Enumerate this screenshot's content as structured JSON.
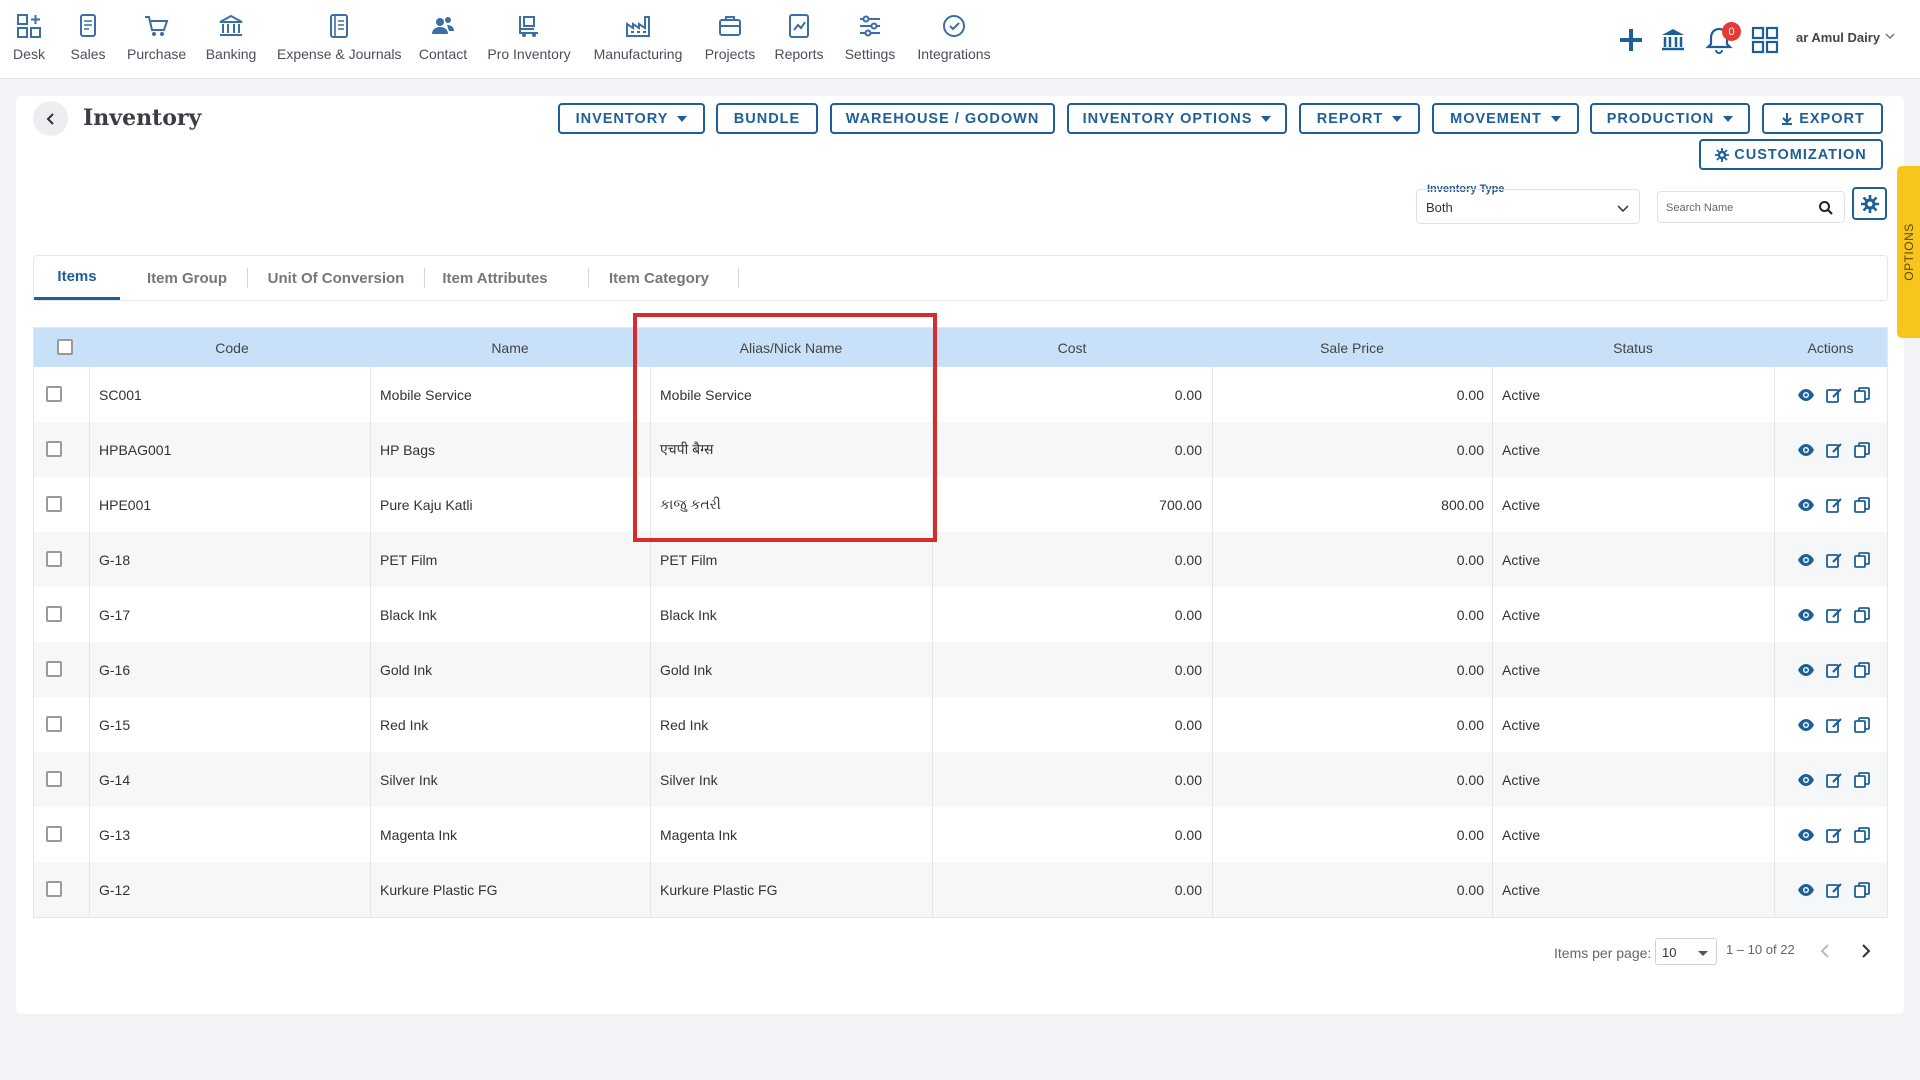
{
  "nav": {
    "items": [
      {
        "label": "Desk",
        "icon": "desk-icon"
      },
      {
        "label": "Sales",
        "icon": "sales-icon"
      },
      {
        "label": "Purchase",
        "icon": "cart-icon"
      },
      {
        "label": "Banking",
        "icon": "bank-icon"
      },
      {
        "label": "Expense & Journals",
        "icon": "journal-icon"
      },
      {
        "label": "Contact",
        "icon": "contacts-icon"
      },
      {
        "label": "Pro Inventory",
        "icon": "inventory-icon"
      },
      {
        "label": "Manufacturing",
        "icon": "factory-icon"
      },
      {
        "label": "Projects",
        "icon": "projects-icon"
      },
      {
        "label": "Reports",
        "icon": "reports-icon"
      },
      {
        "label": "Settings",
        "icon": "settings-sliders-icon"
      },
      {
        "label": "Integrations",
        "icon": "integrations-icon"
      }
    ],
    "notification_count": "0",
    "company": "ar Amul Dairy"
  },
  "page": {
    "title": "Inventory",
    "buttons": {
      "inventory": "INVENTORY",
      "bundle": "BUNDLE",
      "warehouse": "WAREHOUSE / GODOWN",
      "inventory_options": "INVENTORY OPTIONS",
      "report": "REPORT",
      "movement": "MOVEMENT",
      "production": "PRODUCTION",
      "export": "EXPORT",
      "customization": "CUSTOMIZATION"
    },
    "filter": {
      "inventory_type_label": "Inventory Type",
      "inventory_type_value": "Both",
      "search_placeholder": "Search Name"
    },
    "options_tab": "OPTIONS"
  },
  "tabs": [
    "Items",
    "Item Group",
    "Unit Of Conversion",
    "Item Attributes",
    "Item Category"
  ],
  "table": {
    "columns": [
      "Code",
      "Name",
      "Alias/Nick Name",
      "Cost",
      "Sale Price",
      "Status",
      "Actions"
    ],
    "rows": [
      {
        "code": "SC001",
        "name": "Mobile Service",
        "alias": "Mobile Service",
        "cost": "0.00",
        "sale": "0.00",
        "status": "Active"
      },
      {
        "code": "HPBAG001",
        "name": "HP Bags",
        "alias": "एचपी बैग्स",
        "cost": "0.00",
        "sale": "0.00",
        "status": "Active"
      },
      {
        "code": "HPE001",
        "name": "Pure Kaju Katli",
        "alias": "કાજુ કતરી",
        "cost": "700.00",
        "sale": "800.00",
        "status": "Active"
      },
      {
        "code": "G-18",
        "name": "PET Film",
        "alias": "PET Film",
        "cost": "0.00",
        "sale": "0.00",
        "status": "Active"
      },
      {
        "code": "G-17",
        "name": "Black Ink",
        "alias": "Black Ink",
        "cost": "0.00",
        "sale": "0.00",
        "status": "Active"
      },
      {
        "code": "G-16",
        "name": "Gold Ink",
        "alias": "Gold Ink",
        "cost": "0.00",
        "sale": "0.00",
        "status": "Active"
      },
      {
        "code": "G-15",
        "name": "Red Ink",
        "alias": "Red Ink",
        "cost": "0.00",
        "sale": "0.00",
        "status": "Active"
      },
      {
        "code": "G-14",
        "name": "Silver Ink",
        "alias": "Silver Ink",
        "cost": "0.00",
        "sale": "0.00",
        "status": "Active"
      },
      {
        "code": "G-13",
        "name": "Magenta Ink",
        "alias": "Magenta Ink",
        "cost": "0.00",
        "sale": "0.00",
        "status": "Active"
      },
      {
        "code": "G-12",
        "name": "Kurkure Plastic FG",
        "alias": "Kurkure Plastic FG",
        "cost": "0.00",
        "sale": "0.00",
        "status": "Active"
      }
    ]
  },
  "pager": {
    "label": "Items per page:",
    "per_page": "10",
    "range": "1 – 10 of 22"
  },
  "colors": {
    "accent": "#1f5f98",
    "header_bg": "#c8e1f8",
    "highlight": "#d62c2c",
    "options_tab": "#f8c51c",
    "badge": "#e53935"
  }
}
